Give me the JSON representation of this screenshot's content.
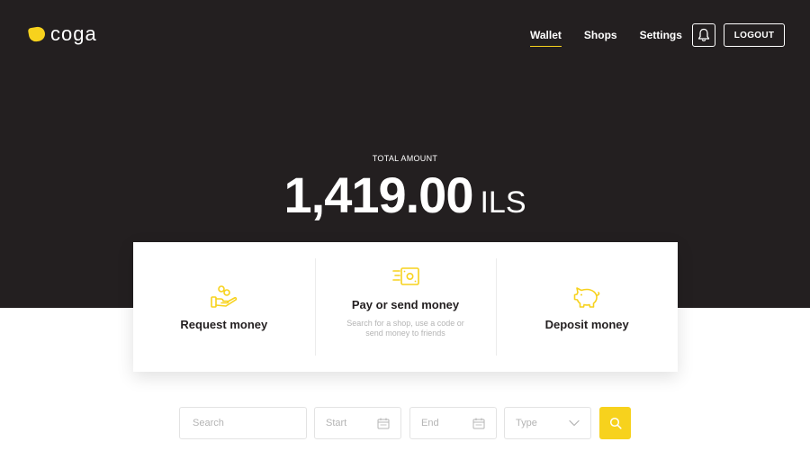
{
  "brand": {
    "name": "coga",
    "accent_color": "#f7d21d",
    "dark_color": "#231f20"
  },
  "nav": {
    "items": [
      {
        "label": "Wallet",
        "active": true
      },
      {
        "label": "Shops",
        "active": false
      },
      {
        "label": "Settings",
        "active": false
      }
    ],
    "notifications_icon": "bell-icon",
    "logout_label": "LOGOUT"
  },
  "wallet": {
    "total_label": "TOTAL AMOUNT",
    "amount": "1,419.00",
    "currency": "ILS"
  },
  "actions": [
    {
      "title": "Request money",
      "subtitle": "",
      "icon": "hand-coins-icon"
    },
    {
      "title": "Pay or send money",
      "subtitle": "Search for a shop, use a code or send money to friends",
      "icon": "cash-send-icon"
    },
    {
      "title": "Deposit money",
      "subtitle": "",
      "icon": "piggy-bank-icon"
    }
  ],
  "filters": {
    "search_placeholder": "Search",
    "start_placeholder": "Start",
    "end_placeholder": "End",
    "type_placeholder": "Type",
    "search_button_icon": "search-icon"
  }
}
